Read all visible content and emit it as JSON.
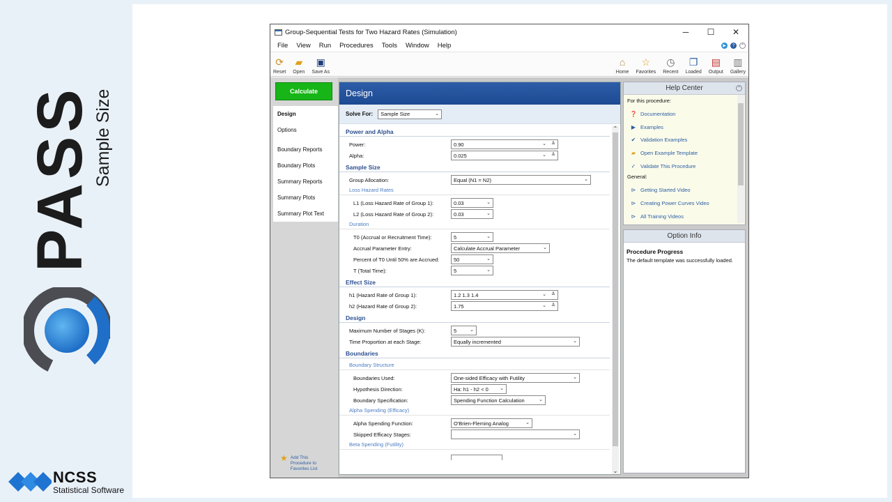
{
  "brand": {
    "product": "PASS",
    "tagline": "Sample Size",
    "company": "NCSS",
    "company_sub": "Statistical Software"
  },
  "window": {
    "title": "Group-Sequential Tests for Two Hazard Rates (Simulation)",
    "controls": [
      "─",
      "☐",
      "✕"
    ]
  },
  "menu": [
    "File",
    "View",
    "Run",
    "Procedures",
    "Tools",
    "Window",
    "Help"
  ],
  "toolbar": {
    "left": [
      {
        "label": "Reset",
        "icon": "reset-icon"
      },
      {
        "label": "Open",
        "icon": "open-folder-icon"
      },
      {
        "label": "Save As",
        "icon": "save-icon"
      }
    ],
    "right": [
      {
        "label": "Home",
        "icon": "home-icon"
      },
      {
        "label": "Favorites",
        "icon": "star-icon"
      },
      {
        "label": "Recent",
        "icon": "clock-icon"
      },
      {
        "label": "Loaded",
        "icon": "windows-icon"
      },
      {
        "label": "Output",
        "icon": "chart-icon"
      },
      {
        "label": "Gallery",
        "icon": "gallery-icon"
      }
    ]
  },
  "nav": {
    "calculate": "Calculate",
    "items": [
      "Design",
      "Options",
      "Boundary Reports",
      "Boundary Plots",
      "Summary Reports",
      "Summary Plots",
      "Summary Plot Text"
    ],
    "add_favorite": [
      "Add This",
      "Procedure to",
      "Favorites List"
    ]
  },
  "design": {
    "header": "Design",
    "solve_for_label": "Solve For:",
    "solve_for_value": "Sample Size",
    "sections": {
      "power_alpha": "Power and Alpha",
      "sample_size": "Sample Size",
      "loss_hazard": "Loss Hazard Rates",
      "duration": "Duration",
      "effect_size": "Effect Size",
      "design": "Design",
      "boundaries": "Boundaries",
      "boundary_structure": "Boundary Structure",
      "alpha_spending": "Alpha Spending (Efficacy)",
      "beta_spending": "Beta Spending (Futility)"
    },
    "fields": {
      "power": {
        "label": "Power:",
        "value": "0.90"
      },
      "alpha": {
        "label": "Alpha:",
        "value": "0.025"
      },
      "group_allocation": {
        "label": "Group Allocation:",
        "value": "Equal (N1 = N2)"
      },
      "l1": {
        "label": "L1 (Loss Hazard Rate of Group 1):",
        "value": "0.03"
      },
      "l2": {
        "label": "L2 (Loss Hazard Rate of Group 2):",
        "value": "0.03"
      },
      "t0": {
        "label": "T0 (Accrual or Recruitment Time):",
        "value": "5"
      },
      "accrual_entry": {
        "label": "Accrual Parameter Entry:",
        "value": "Calculate Accrual Parameter"
      },
      "percent_t0": {
        "label": "Percent of T0 Until 50% are Accrued:",
        "value": "50"
      },
      "t_total": {
        "label": "T (Total Time):",
        "value": "5"
      },
      "h1": {
        "label": "h1 (Hazard Rate of Group 1):",
        "value": "1.2 1.3 1.4"
      },
      "h2": {
        "label": "h2 (Hazard Rate of Group 2):",
        "value": "1.75"
      },
      "max_stages": {
        "label": "Maximum Number of Stages (K):",
        "value": "5"
      },
      "time_proportion": {
        "label": "Time Proportion at each Stage:",
        "value": "Equally incremented"
      },
      "boundaries_used": {
        "label": "Boundaries Used:",
        "value": "One-sided Efficacy with Futility"
      },
      "hypothesis_direction": {
        "label": "Hypothesis Direction:",
        "value": "Ha: h1 - h2 < 0"
      },
      "boundary_spec": {
        "label": "Boundary Specification:",
        "value": "Spending Function Calculation"
      },
      "alpha_spending_fn": {
        "label": "Alpha Spending Function:",
        "value": "O'Brien-Fleming Analog"
      },
      "skipped_efficacy": {
        "label": "Skipped Efficacy Stages:",
        "value": ""
      }
    }
  },
  "help_center": {
    "title": "Help Center",
    "for_procedure": "For this procedure:",
    "procedure_items": [
      {
        "label": "Documentation",
        "icon": "question-icon"
      },
      {
        "label": "Examples",
        "icon": "examples-icon"
      },
      {
        "label": "Validation Examples",
        "icon": "validation-icon"
      },
      {
        "label": "Open Example Template",
        "icon": "template-icon"
      },
      {
        "label": "Validate This Procedure",
        "icon": "check-icon"
      }
    ],
    "general": "General:",
    "general_items": [
      {
        "label": "Getting Started Video",
        "icon": "play-icon"
      },
      {
        "label": "Creating Power Curves Video",
        "icon": "play-icon"
      },
      {
        "label": "All Training Videos",
        "icon": "play-icon"
      }
    ]
  },
  "option_info": {
    "title": "Option Info",
    "progress_title": "Procedure Progress",
    "message": "The default template was successfully loaded."
  },
  "colors": {
    "calculate_green": "#17b517",
    "header_blue": "#1c4a92",
    "section_text": "#2b4f8f",
    "link_blue": "#2b5fa3"
  }
}
